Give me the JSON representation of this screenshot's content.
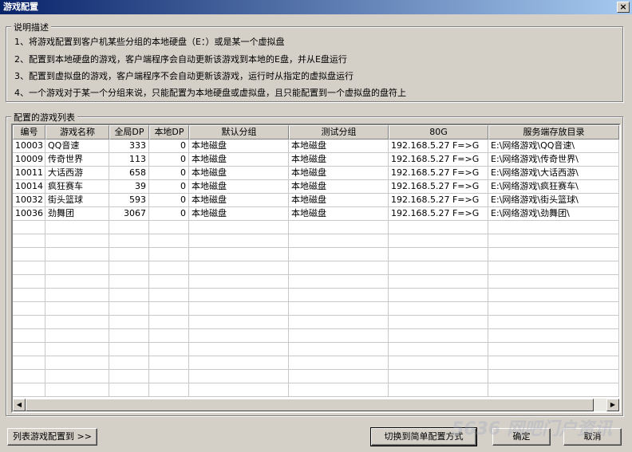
{
  "window": {
    "title": "游戏配置",
    "close_glyph": "×"
  },
  "description": {
    "label": "说明描述",
    "lines": [
      "1、将游戏配置到客户机某些分组的本地硬盘（E：）或是某一个虚拟盘",
      "2、配置到本地硬盘的游戏，客户端程序会自动更新该游戏到本地的E盘，并从E盘运行",
      "3、配置到虚拟盘的游戏，客户端程序不会自动更新该游戏，运行时从指定的虚拟盘运行",
      "4、一个游戏对于某一个分组来说，只能配置为本地硬盘或虚拟盘，且只能配置到一个虚拟盘的盘符上"
    ]
  },
  "list": {
    "label": "配置的游戏列表",
    "columns": [
      "编号",
      "游戏名称",
      "全局DP",
      "本地DP",
      "默认分组",
      "测试分组",
      "80G",
      "服务端存放目录"
    ],
    "rows": [
      [
        "10003",
        "QQ音速",
        "333",
        "0",
        "本地磁盘",
        "本地磁盘",
        "192.168.5.27 F=>G",
        "E:\\网络游戏\\QQ音速\\"
      ],
      [
        "10009",
        "传奇世界",
        "113",
        "0",
        "本地磁盘",
        "本地磁盘",
        "192.168.5.27 F=>G",
        "E:\\网络游戏\\传奇世界\\"
      ],
      [
        "10011",
        "大话西游",
        "658",
        "0",
        "本地磁盘",
        "本地磁盘",
        "192.168.5.27 F=>G",
        "E:\\网络游戏\\大话西游\\"
      ],
      [
        "10014",
        "疯狂赛车",
        "39",
        "0",
        "本地磁盘",
        "本地磁盘",
        "192.168.5.27 F=>G",
        "E:\\网络游戏\\疯狂赛车\\"
      ],
      [
        "10032",
        "街头篮球",
        "593",
        "0",
        "本地磁盘",
        "本地磁盘",
        "192.168.5.27 F=>G",
        "E:\\网络游戏\\街头篮球\\"
      ],
      [
        "10036",
        "劲舞团",
        "3067",
        "0",
        "本地磁盘",
        "本地磁盘",
        "192.168.5.27 F=>G",
        "E:\\网络游戏\\劲舞团\\"
      ]
    ],
    "empty_rows": 13
  },
  "buttons": {
    "list_config": "列表游戏配置到 >>",
    "switch_mode": "切换到简单配置方式",
    "ok": "确定",
    "cancel": "取消"
  },
  "watermark": "5636 网吧门户资讯"
}
